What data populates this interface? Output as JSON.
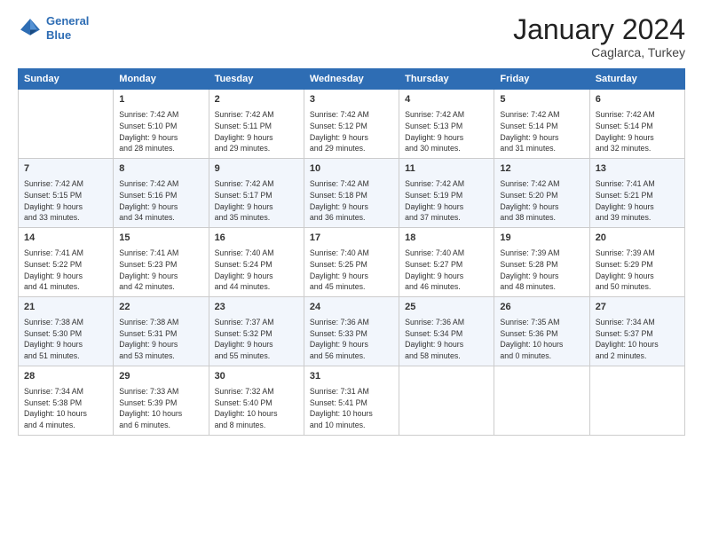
{
  "header": {
    "logo_line1": "General",
    "logo_line2": "Blue",
    "month_title": "January 2024",
    "location": "Caglarca, Turkey"
  },
  "columns": [
    "Sunday",
    "Monday",
    "Tuesday",
    "Wednesday",
    "Thursday",
    "Friday",
    "Saturday"
  ],
  "weeks": [
    [
      {
        "num": "",
        "detail": ""
      },
      {
        "num": "1",
        "detail": "Sunrise: 7:42 AM\nSunset: 5:10 PM\nDaylight: 9 hours\nand 28 minutes."
      },
      {
        "num": "2",
        "detail": "Sunrise: 7:42 AM\nSunset: 5:11 PM\nDaylight: 9 hours\nand 29 minutes."
      },
      {
        "num": "3",
        "detail": "Sunrise: 7:42 AM\nSunset: 5:12 PM\nDaylight: 9 hours\nand 29 minutes."
      },
      {
        "num": "4",
        "detail": "Sunrise: 7:42 AM\nSunset: 5:13 PM\nDaylight: 9 hours\nand 30 minutes."
      },
      {
        "num": "5",
        "detail": "Sunrise: 7:42 AM\nSunset: 5:14 PM\nDaylight: 9 hours\nand 31 minutes."
      },
      {
        "num": "6",
        "detail": "Sunrise: 7:42 AM\nSunset: 5:14 PM\nDaylight: 9 hours\nand 32 minutes."
      }
    ],
    [
      {
        "num": "7",
        "detail": "Sunrise: 7:42 AM\nSunset: 5:15 PM\nDaylight: 9 hours\nand 33 minutes."
      },
      {
        "num": "8",
        "detail": "Sunrise: 7:42 AM\nSunset: 5:16 PM\nDaylight: 9 hours\nand 34 minutes."
      },
      {
        "num": "9",
        "detail": "Sunrise: 7:42 AM\nSunset: 5:17 PM\nDaylight: 9 hours\nand 35 minutes."
      },
      {
        "num": "10",
        "detail": "Sunrise: 7:42 AM\nSunset: 5:18 PM\nDaylight: 9 hours\nand 36 minutes."
      },
      {
        "num": "11",
        "detail": "Sunrise: 7:42 AM\nSunset: 5:19 PM\nDaylight: 9 hours\nand 37 minutes."
      },
      {
        "num": "12",
        "detail": "Sunrise: 7:42 AM\nSunset: 5:20 PM\nDaylight: 9 hours\nand 38 minutes."
      },
      {
        "num": "13",
        "detail": "Sunrise: 7:41 AM\nSunset: 5:21 PM\nDaylight: 9 hours\nand 39 minutes."
      }
    ],
    [
      {
        "num": "14",
        "detail": "Sunrise: 7:41 AM\nSunset: 5:22 PM\nDaylight: 9 hours\nand 41 minutes."
      },
      {
        "num": "15",
        "detail": "Sunrise: 7:41 AM\nSunset: 5:23 PM\nDaylight: 9 hours\nand 42 minutes."
      },
      {
        "num": "16",
        "detail": "Sunrise: 7:40 AM\nSunset: 5:24 PM\nDaylight: 9 hours\nand 44 minutes."
      },
      {
        "num": "17",
        "detail": "Sunrise: 7:40 AM\nSunset: 5:25 PM\nDaylight: 9 hours\nand 45 minutes."
      },
      {
        "num": "18",
        "detail": "Sunrise: 7:40 AM\nSunset: 5:27 PM\nDaylight: 9 hours\nand 46 minutes."
      },
      {
        "num": "19",
        "detail": "Sunrise: 7:39 AM\nSunset: 5:28 PM\nDaylight: 9 hours\nand 48 minutes."
      },
      {
        "num": "20",
        "detail": "Sunrise: 7:39 AM\nSunset: 5:29 PM\nDaylight: 9 hours\nand 50 minutes."
      }
    ],
    [
      {
        "num": "21",
        "detail": "Sunrise: 7:38 AM\nSunset: 5:30 PM\nDaylight: 9 hours\nand 51 minutes."
      },
      {
        "num": "22",
        "detail": "Sunrise: 7:38 AM\nSunset: 5:31 PM\nDaylight: 9 hours\nand 53 minutes."
      },
      {
        "num": "23",
        "detail": "Sunrise: 7:37 AM\nSunset: 5:32 PM\nDaylight: 9 hours\nand 55 minutes."
      },
      {
        "num": "24",
        "detail": "Sunrise: 7:36 AM\nSunset: 5:33 PM\nDaylight: 9 hours\nand 56 minutes."
      },
      {
        "num": "25",
        "detail": "Sunrise: 7:36 AM\nSunset: 5:34 PM\nDaylight: 9 hours\nand 58 minutes."
      },
      {
        "num": "26",
        "detail": "Sunrise: 7:35 AM\nSunset: 5:36 PM\nDaylight: 10 hours\nand 0 minutes."
      },
      {
        "num": "27",
        "detail": "Sunrise: 7:34 AM\nSunset: 5:37 PM\nDaylight: 10 hours\nand 2 minutes."
      }
    ],
    [
      {
        "num": "28",
        "detail": "Sunrise: 7:34 AM\nSunset: 5:38 PM\nDaylight: 10 hours\nand 4 minutes."
      },
      {
        "num": "29",
        "detail": "Sunrise: 7:33 AM\nSunset: 5:39 PM\nDaylight: 10 hours\nand 6 minutes."
      },
      {
        "num": "30",
        "detail": "Sunrise: 7:32 AM\nSunset: 5:40 PM\nDaylight: 10 hours\nand 8 minutes."
      },
      {
        "num": "31",
        "detail": "Sunrise: 7:31 AM\nSunset: 5:41 PM\nDaylight: 10 hours\nand 10 minutes."
      },
      {
        "num": "",
        "detail": ""
      },
      {
        "num": "",
        "detail": ""
      },
      {
        "num": "",
        "detail": ""
      }
    ]
  ]
}
